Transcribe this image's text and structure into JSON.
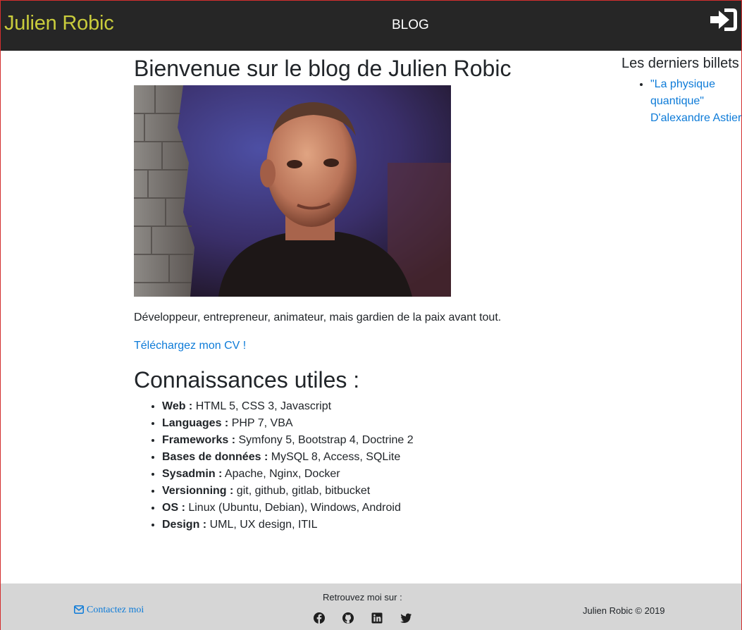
{
  "navbar": {
    "brand": "Julien Robic",
    "blog_link": "BLOG",
    "login_icon": "sign-in-icon"
  },
  "main": {
    "title": "Bienvenue sur le blog de Julien Robic",
    "photo_icon": "portrait-photo",
    "intro": "Développeur, entrepreneur, animateur, mais gardien de la paix avant tout.",
    "cv_link": "Téléchargez mon CV !",
    "skills_title": "Connaissances utiles :",
    "skills": [
      {
        "label": "Web :",
        "value": "HTML 5, CSS 3, Javascript"
      },
      {
        "label": "Languages :",
        "value": "PHP 7, VBA"
      },
      {
        "label": "Frameworks :",
        "value": "Symfony 5, Bootstrap 4, Doctrine 2"
      },
      {
        "label": "Bases de données :",
        "value": "MySQL 8, Access, SQLite"
      },
      {
        "label": "Sysadmin :",
        "value": "Apache, Nginx, Docker"
      },
      {
        "label": "Versionning :",
        "value": "git, github, gitlab, bitbucket"
      },
      {
        "label": "OS :",
        "value": "Linux (Ubuntu, Debian), Windows, Android"
      },
      {
        "label": "Design :",
        "value": "UML, UX design, ITIL"
      }
    ]
  },
  "sidebar": {
    "title": "Les derniers billets :",
    "posts": [
      {
        "title": "\"La physique quantique\" D'alexandre Astier"
      }
    ]
  },
  "footer": {
    "contact": "Contactez moi",
    "find_me": "Retrouvez moi sur :",
    "socials": [
      "facebook-icon",
      "github-icon",
      "linkedin-icon",
      "twitter-icon"
    ],
    "copyright": "Julien Robic © 2019"
  },
  "colors": {
    "navbar_bg": "#262626",
    "brand": "#c9cc3c",
    "link": "#0d7bd8",
    "footer_bg": "#d6d6d6"
  }
}
